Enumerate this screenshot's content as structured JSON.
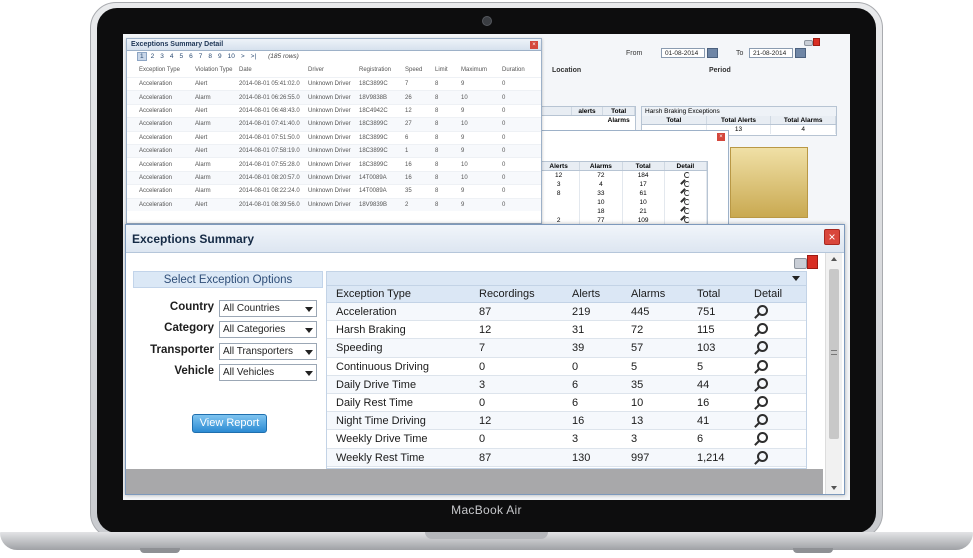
{
  "device": {
    "brand": "MacBook Air"
  },
  "background": {
    "filter_labels": {
      "from": "From",
      "to": "To",
      "location": "Location",
      "period": "Period"
    },
    "dates": {
      "from": "01-08-2014",
      "to": "21-08-2014"
    },
    "harsh_panel": {
      "title": "Harsh Braking Exceptions",
      "headers": [
        "Total",
        "Total Alerts",
        "Total Alarms"
      ],
      "values": [
        "",
        "13",
        "4"
      ]
    },
    "left_panel": {
      "headers": [
        "",
        "alerts",
        "Total Alarms"
      ]
    },
    "mini_table": {
      "headers": [
        "Alerts",
        "Alarms",
        "Total",
        "Detail"
      ],
      "rows": [
        [
          "12",
          "72",
          "184"
        ],
        [
          "3",
          "4",
          "17"
        ],
        [
          "8",
          "33",
          "61"
        ],
        [
          "",
          "10",
          "10"
        ],
        [
          "",
          "18",
          "21"
        ],
        [
          "2",
          "77",
          "109"
        ]
      ]
    }
  },
  "detail_dialog": {
    "title": "Exceptions Summary Detail",
    "pager": {
      "pages": [
        "1",
        "2",
        "3",
        "4",
        "5",
        "6",
        "7",
        "8",
        "9",
        "10",
        ">",
        ">|"
      ],
      "rows_label": "(185 rows)"
    },
    "headers": [
      "Exception Type",
      "Violation Type",
      "Date",
      "Driver",
      "Registration",
      "Speed",
      "Limit",
      "Maximum",
      "Duration"
    ],
    "rows": [
      [
        "Acceleration",
        "Alert",
        "2014-08-01 05:41:02.0",
        "Unknown Driver",
        "18C3899C",
        "7",
        "8",
        "9",
        "0"
      ],
      [
        "Acceleration",
        "Alarm",
        "2014-08-01 06:26:55.0",
        "Unknown Driver",
        "18V9838B",
        "26",
        "8",
        "10",
        "0"
      ],
      [
        "Acceleration",
        "Alert",
        "2014-08-01 06:48:43.0",
        "Unknown Driver",
        "18C4942C",
        "12",
        "8",
        "9",
        "0"
      ],
      [
        "Acceleration",
        "Alarm",
        "2014-08-01 07:41:40.0",
        "Unknown Driver",
        "18C3899C",
        "27",
        "8",
        "10",
        "0"
      ],
      [
        "Acceleration",
        "Alert",
        "2014-08-01 07:51:50.0",
        "Unknown Driver",
        "18C3899C",
        "6",
        "8",
        "9",
        "0"
      ],
      [
        "Acceleration",
        "Alert",
        "2014-08-01 07:58:19.0",
        "Unknown Driver",
        "18C3899C",
        "1",
        "8",
        "9",
        "0"
      ],
      [
        "Acceleration",
        "Alarm",
        "2014-08-01 07:55:28.0",
        "Unknown Driver",
        "18C3899C",
        "16",
        "8",
        "10",
        "0"
      ],
      [
        "Acceleration",
        "Alarm",
        "2014-08-01 08:20:57.0",
        "Unknown Driver",
        "14T0089A",
        "16",
        "8",
        "10",
        "0"
      ],
      [
        "Acceleration",
        "Alarm",
        "2014-08-01 08:22:24.0",
        "Unknown Driver",
        "14T0089A",
        "35",
        "8",
        "9",
        "0"
      ],
      [
        "Acceleration",
        "Alert",
        "2014-08-01 08:39:56.0",
        "Unknown Driver",
        "18V9839B",
        "2",
        "8",
        "9",
        "0"
      ]
    ]
  },
  "summary": {
    "title": "Exceptions Summary",
    "options": {
      "heading": "Select Exception Options",
      "fields": [
        {
          "label": "Country",
          "value": "All Countries"
        },
        {
          "label": "Category",
          "value": "All Categories"
        },
        {
          "label": "Transporter",
          "value": "All Transporters"
        },
        {
          "label": "Vehicle",
          "value": "All Vehicles"
        }
      ],
      "button": "View Report"
    },
    "table": {
      "headers": [
        "Exception Type",
        "Recordings",
        "Alerts",
        "Alarms",
        "Total",
        "Detail"
      ],
      "rows": [
        [
          "Acceleration",
          "87",
          "219",
          "445",
          "751"
        ],
        [
          "Harsh Braking",
          "12",
          "31",
          "72",
          "115"
        ],
        [
          "Speeding",
          "7",
          "39",
          "57",
          "103"
        ],
        [
          "Continuous Driving",
          "0",
          "0",
          "5",
          "5"
        ],
        [
          "Daily Drive Time",
          "3",
          "6",
          "35",
          "44"
        ],
        [
          "Daily Rest Time",
          "0",
          "6",
          "10",
          "16"
        ],
        [
          "Night Time Driving",
          "12",
          "16",
          "13",
          "41"
        ],
        [
          "Weekly Drive Time",
          "0",
          "3",
          "3",
          "6"
        ],
        [
          "Weekly Rest Time",
          "87",
          "130",
          "997",
          "1,214"
        ]
      ]
    }
  }
}
